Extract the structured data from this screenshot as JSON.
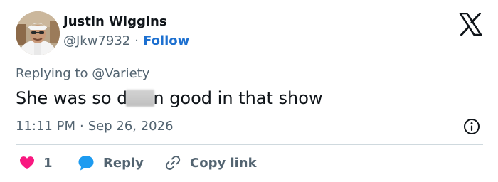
{
  "author": {
    "display_name": "Justin Wiggins",
    "handle": "@Jkw7932",
    "separator": "·",
    "follow_label": "Follow"
  },
  "reply_context": {
    "prefix": "Replying to",
    "mention": "@Variety"
  },
  "tweet": {
    "text_before": "She was so d",
    "text_after": "n good in that show"
  },
  "timestamp": {
    "time": "11:11 PM",
    "separator": "·",
    "date": "Sep 26, 2026"
  },
  "actions": {
    "like_count": "1",
    "reply_label": "Reply",
    "copy_label": "Copy link"
  },
  "colors": {
    "link": "#1d70d0",
    "heart": "#f91880",
    "reply_bubble": "#1d9bf0",
    "muted": "#536471",
    "text": "#0f1419"
  },
  "icons": [
    "x-logo-icon",
    "info-icon",
    "heart-icon",
    "reply-bubble-icon",
    "link-icon"
  ]
}
